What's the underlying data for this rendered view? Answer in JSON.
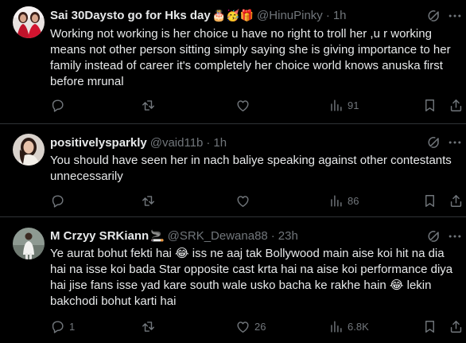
{
  "tweets": [
    {
      "display_name": "Sai 30Daysto go for Hks day",
      "emojis": "🎂🥳🎁",
      "handle": "@HinuPinky",
      "time": "1h",
      "text": "Working not working is her choice u have no right to troll her ,u r working means not other person sitting simply saying she is giving importance to her family instead of career it's completely her choice world knows anuska first before mrunal",
      "views": "91",
      "replies": "",
      "reposts": "",
      "likes": ""
    },
    {
      "display_name": "positivelysparkly",
      "emojis": "",
      "handle": "@vaid11b",
      "time": "1h",
      "text": "You should have seen her in nach baliye speaking against other contestants unnecessarily",
      "views": "86",
      "replies": "",
      "reposts": "",
      "likes": ""
    },
    {
      "display_name": "M Crzyy SRKiann",
      "emojis": "🚬",
      "handle": "@SRK_Dewana88",
      "time": "23h",
      "text": "Ye aurat bohut fekti hai 😂 iss ne aaj tak Bollywood main aise koi hit na dia hai na isse koi bada Star opposite cast krta hai na aise koi performance diya hai jise fans isse yad kare south wale usko bacha ke rakhe hain 😂 lekin bakchodi bohut karti hai",
      "views": "6.8K",
      "replies": "1",
      "reposts": "",
      "likes": "26"
    }
  ],
  "icons": {
    "grok": "grok-icon",
    "more": "more-options-icon",
    "reply": "reply-icon",
    "repost": "repost-icon",
    "like": "like-icon",
    "views": "views-icon",
    "bookmark": "bookmark-icon",
    "share": "share-icon"
  },
  "colors": {
    "background": "#000000",
    "text": "#e7e9ea",
    "muted": "#71767b",
    "divider": "#2f3336"
  }
}
